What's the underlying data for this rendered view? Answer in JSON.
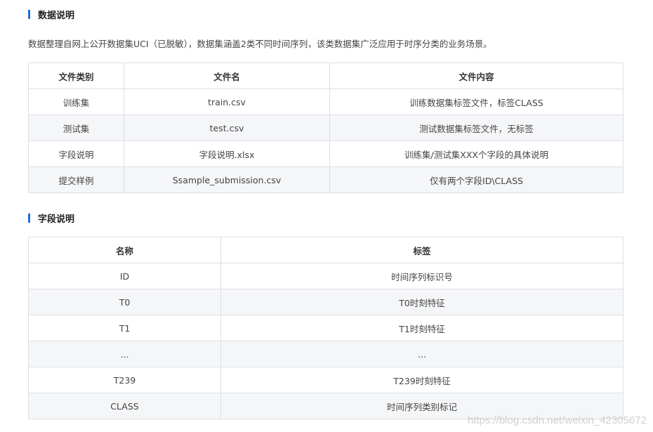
{
  "section1": {
    "title": "数据说明",
    "description": "数据整理自网上公开数据集UCI（已脱敏），数据集涵盖2类不同时间序列，该类数据集广泛应用于时序分类的业务场景。"
  },
  "files_table": {
    "headers": [
      "文件类别",
      "文件名",
      "文件内容"
    ],
    "rows": [
      [
        "训练集",
        "train.csv",
        "训练数据集标签文件，标签CLASS"
      ],
      [
        "测试集",
        "test.csv",
        "测试数据集标签文件，无标签"
      ],
      [
        "字段说明",
        "字段说明.xlsx",
        "训练集/测试集XXX个字段的具体说明"
      ],
      [
        "提交样例",
        "Ssample_submission.csv",
        "仅有两个字段ID\\CLASS"
      ]
    ]
  },
  "section2": {
    "title": "字段说明"
  },
  "fields_table": {
    "headers": [
      "名称",
      "标签"
    ],
    "rows": [
      [
        "ID",
        "时间序列标识号"
      ],
      [
        "T0",
        "T0时刻特征"
      ],
      [
        "T1",
        "T1时刻特征"
      ],
      [
        "...",
        "..."
      ],
      [
        "T239",
        "T239时刻特征"
      ],
      [
        "CLASS",
        "时间序列类别标记"
      ]
    ]
  },
  "watermark": "https://blog.csdn.net/weixin_42305672",
  "colors": {
    "accent": "#1f6fe0",
    "border": "#dcdfe6",
    "stripe": "#f5f6f8"
  }
}
